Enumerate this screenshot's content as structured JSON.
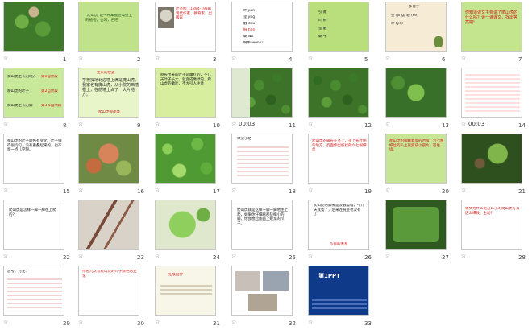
{
  "slides": [
    {
      "number": "1",
      "has_timing": false,
      "timing": ""
    },
    {
      "number": "2",
      "has_timing": false,
      "timing": "",
      "text": "\"爬山虎\"是一种攀援在墙壁上的植物，也叫，色吧"
    },
    {
      "number": "3",
      "has_timing": false,
      "timing": "",
      "text": "叶圣陶（1894-1988）现代作家、教育家、出版家"
    },
    {
      "number": "4",
      "has_timing": false,
      "timing": "",
      "lines": [
        "叶 jiǎn",
        "茎 jīng",
        "触 chù",
        "痕 hén",
        "蜗 wō",
        "蜗牛 wōniú"
      ]
    },
    {
      "number": "5",
      "has_timing": false,
      "timing": "",
      "lines": [
        "引 嫩",
        "叶 柄",
        "茎 触",
        "蜗 牛"
      ]
    },
    {
      "number": "6",
      "has_timing": false,
      "timing": "",
      "title": "多音字",
      "lines": [
        "茎 (jìng)  颗 (kē)",
        "叶 (yè)"
      ]
    },
    {
      "number": "7",
      "has_timing": false,
      "timing": "",
      "text": "你知道课文主要讲了爬山虎的什么吗？读一读课文，找出答案吧!"
    },
    {
      "number": "8",
      "has_timing": false,
      "timing": "",
      "lines": [
        "爬山虎生长的地方",
        "第1自然段",
        "爬山虎的叶子",
        "第2自然段",
        "爬山虎生长的脚",
        "第3-5自然段"
      ]
    },
    {
      "number": "9",
      "has_timing": false,
      "timing": "",
      "title": "生长的位置",
      "text": "学校操场北边墙上满是爬山虎。我家也有爬山虎，从小院的西墙根上，在前墙上占了一大片地方。",
      "footer": "爬山虎很茂盛"
    },
    {
      "number": "10",
      "has_timing": false,
      "timing": "",
      "text": "刚长出来的叶子是嫩红的，不几天叶子长大，就变成嫩绿的，爬山虎的嫩叶，不大引人注意"
    },
    {
      "number": "11",
      "has_timing": true,
      "timing": "00:03"
    },
    {
      "number": "12",
      "has_timing": false,
      "timing": ""
    },
    {
      "number": "13",
      "has_timing": false,
      "timing": ""
    },
    {
      "number": "14",
      "has_timing": true,
      "timing": "00:03"
    },
    {
      "number": "15",
      "has_timing": false,
      "timing": "",
      "text": "爬山虎的叶子颜色有变化，叶子铺得很均匀，没有重叠起来的，也不留一点儿空隙。"
    },
    {
      "number": "16",
      "has_timing": false,
      "timing": ""
    },
    {
      "number": "17",
      "has_timing": false,
      "timing": ""
    },
    {
      "number": "18",
      "has_timing": false,
      "timing": "",
      "title": "课堂小结"
    },
    {
      "number": "19",
      "has_timing": false,
      "timing": "",
      "text": "爬山虎的脚长在茎上，茎上长叶柄的地方，反面伸出枝状的六七根细丝"
    },
    {
      "number": "20",
      "has_timing": false,
      "timing": "",
      "text": "爬山虎的脚触着墙的时候，六七根细丝的头上就变成小圆片，巴住墙。"
    },
    {
      "number": "21",
      "has_timing": false,
      "timing": ""
    },
    {
      "number": "22",
      "has_timing": false,
      "timing": "",
      "text": "爬山虎是怎样一脚一脚往上爬的？"
    },
    {
      "number": "23",
      "has_timing": false,
      "timing": ""
    },
    {
      "number": "24",
      "has_timing": false,
      "timing": ""
    },
    {
      "number": "25",
      "has_timing": false,
      "timing": "",
      "text": "爬山虎就是这样一脚一脚地往上爬，如果你仔细看那些细小的脚，你会想起图画上蛟龙的爪子。"
    },
    {
      "number": "26",
      "has_timing": false,
      "timing": "",
      "text": "爬山虎的脚要是没触着墙，不几天就萎了，后来连痕迹也没有了。",
      "footer": "写得的关系"
    },
    {
      "number": "27",
      "has_timing": false,
      "timing": ""
    },
    {
      "number": "28",
      "has_timing": false,
      "timing": "",
      "text": "课文为什么把这么小的爬山虎写得这么细致、生动？"
    },
    {
      "number": "29",
      "has_timing": false,
      "timing": "",
      "title": "思考、讨论："
    },
    {
      "number": "30",
      "has_timing": false,
      "timing": "",
      "text": "作者几次写爬山虎的叶子颜色的变化"
    },
    {
      "number": "31",
      "has_timing": false,
      "timing": "",
      "title": "拓展延伸"
    },
    {
      "number": "32",
      "has_timing": false,
      "timing": ""
    },
    {
      "number": "33",
      "has_timing": false,
      "timing": "",
      "title": "第1PPT"
    }
  ]
}
